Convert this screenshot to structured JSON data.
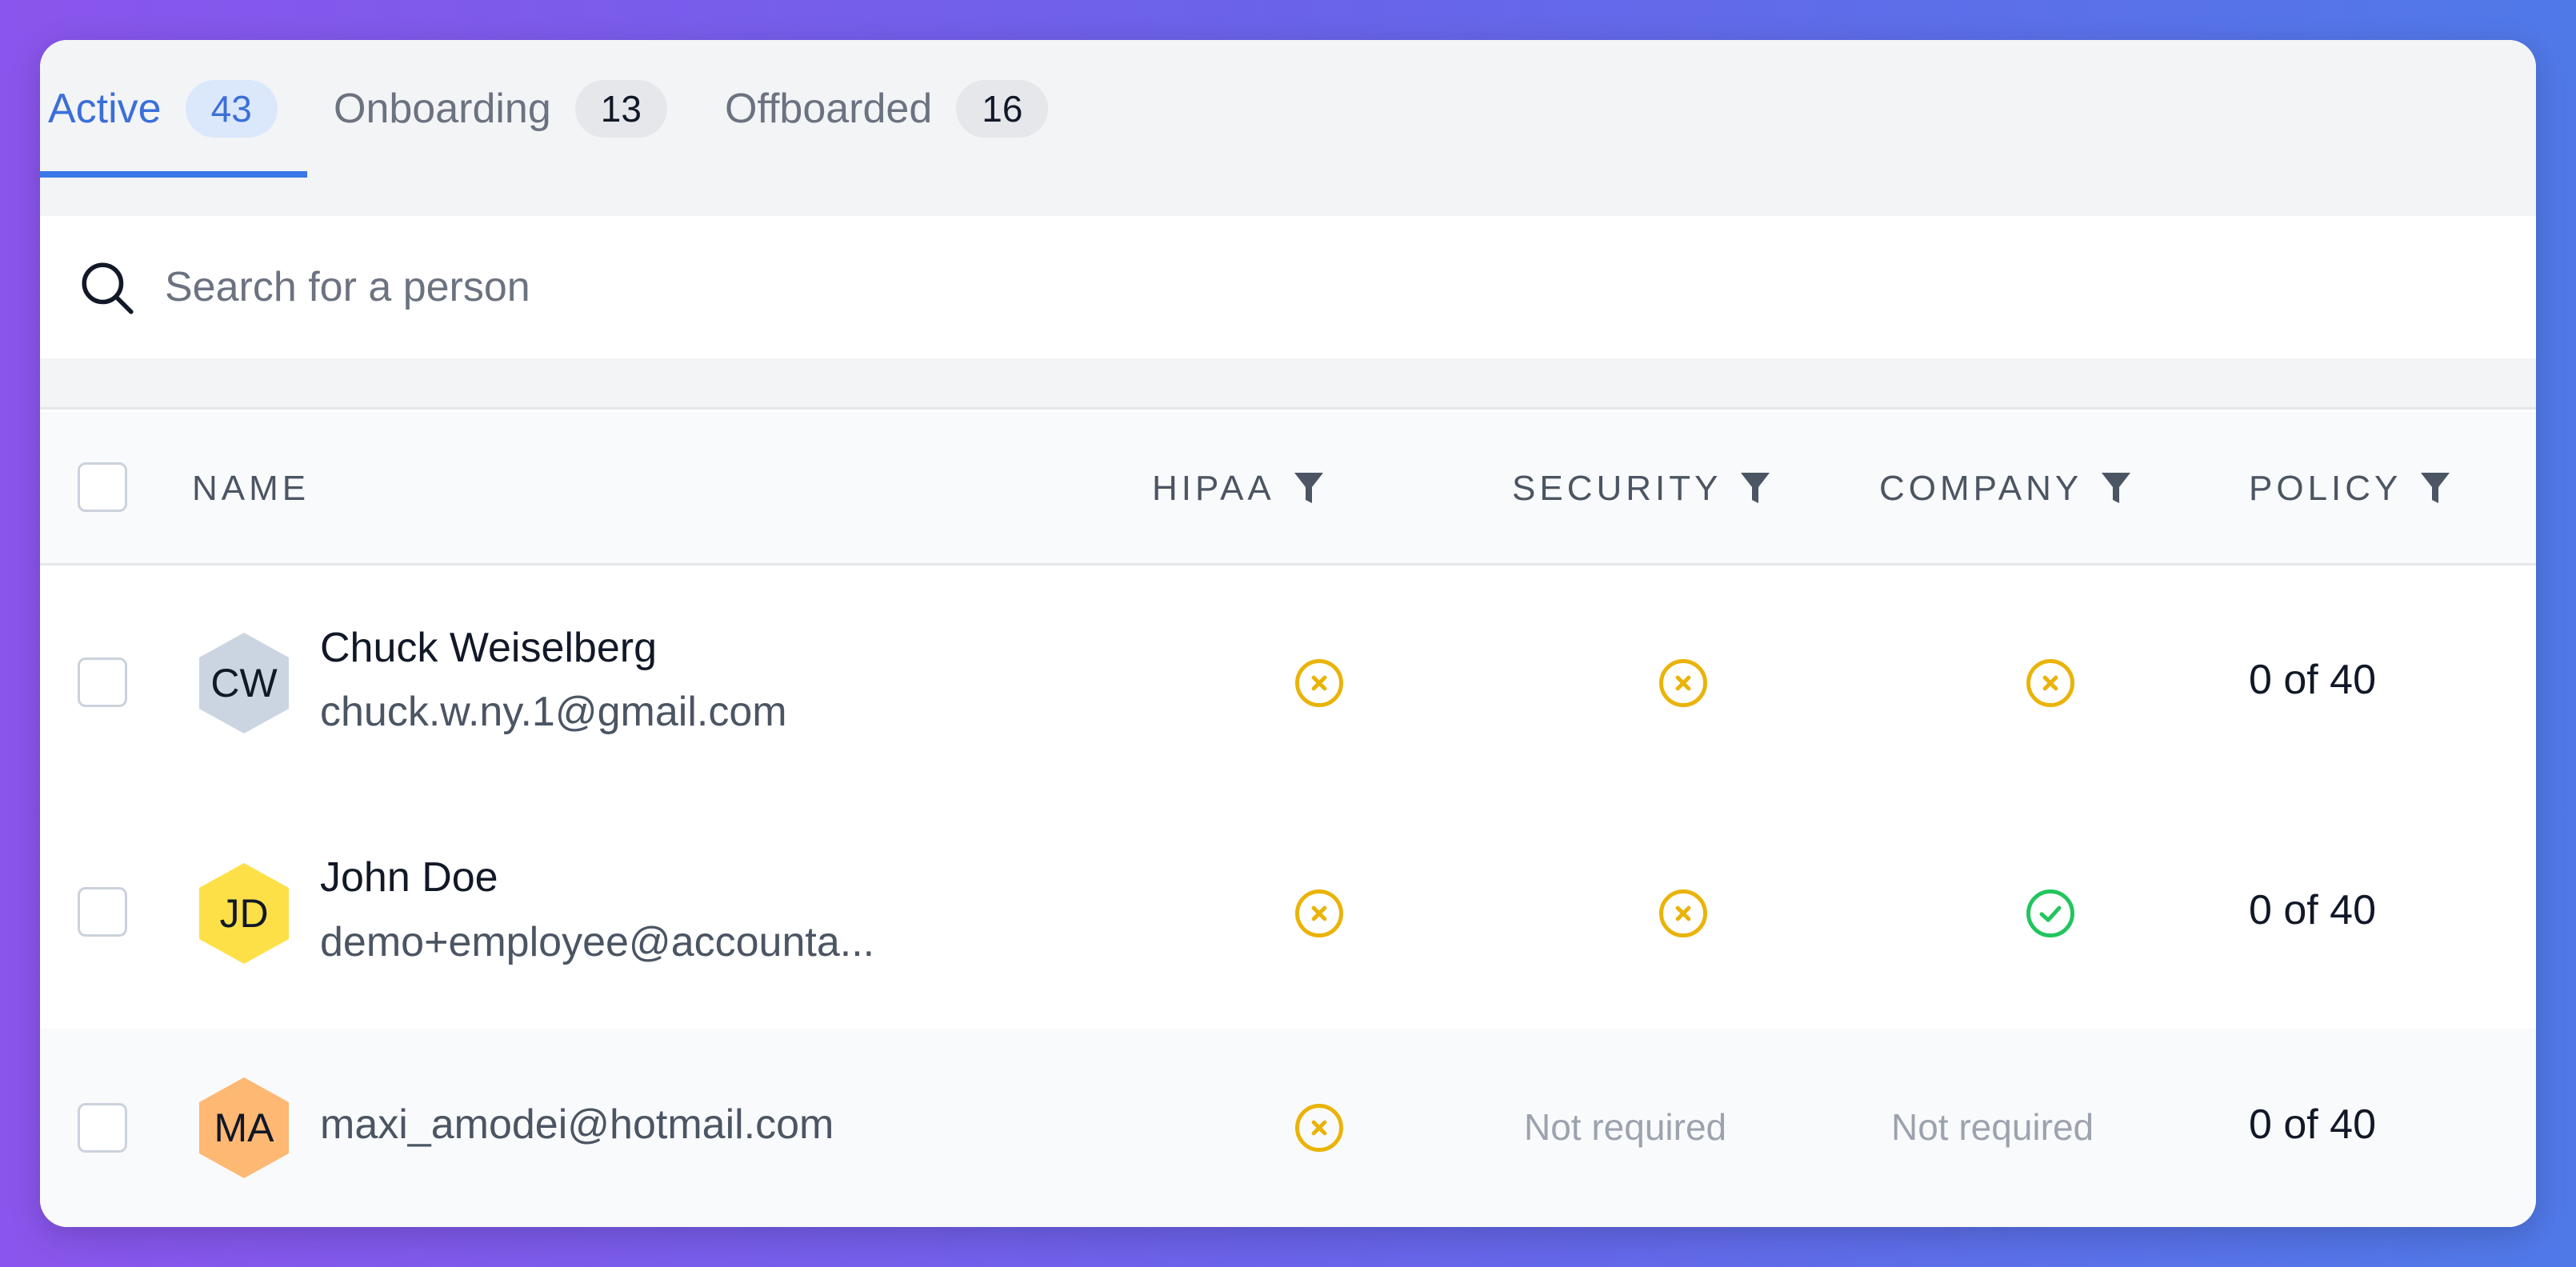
{
  "tabs": [
    {
      "label": "Active",
      "count": "43"
    },
    {
      "label": "Onboarding",
      "count": "13"
    },
    {
      "label": "Offboarded",
      "count": "16"
    }
  ],
  "search": {
    "placeholder": "Search for a person",
    "value": ""
  },
  "columns": {
    "name": "NAME",
    "hipaa": "HIPAA",
    "security": "SECURITY",
    "company": "COMPANY",
    "policy": "POLICY"
  },
  "rows": [
    {
      "initials": "CW",
      "name": "Chuck Weiselberg",
      "email": "chuck.w.ny.1@gmail.com",
      "avatar_color": "#cbd5e1",
      "hipaa": "incomplete-icon",
      "security": "incomplete-icon",
      "company": "incomplete-icon",
      "policy": "0 of 40"
    },
    {
      "initials": "JD",
      "name": "John Doe",
      "email": "demo+employee@accounta...",
      "avatar_color": "#fde047",
      "hipaa": "incomplete-icon",
      "security": "incomplete-icon",
      "company": "complete-icon",
      "policy": "0 of 40"
    },
    {
      "initials": "MA",
      "name": "",
      "email": "maxi_amodei@hotmail.com",
      "avatar_color": "#fdb874",
      "hipaa": "incomplete-icon",
      "security_text": "Not required",
      "company_text": "Not required",
      "policy": "0 of 40"
    }
  ],
  "colors": {
    "accent": "#3b78e7",
    "warning": "#eab308",
    "success": "#22c55e"
  }
}
